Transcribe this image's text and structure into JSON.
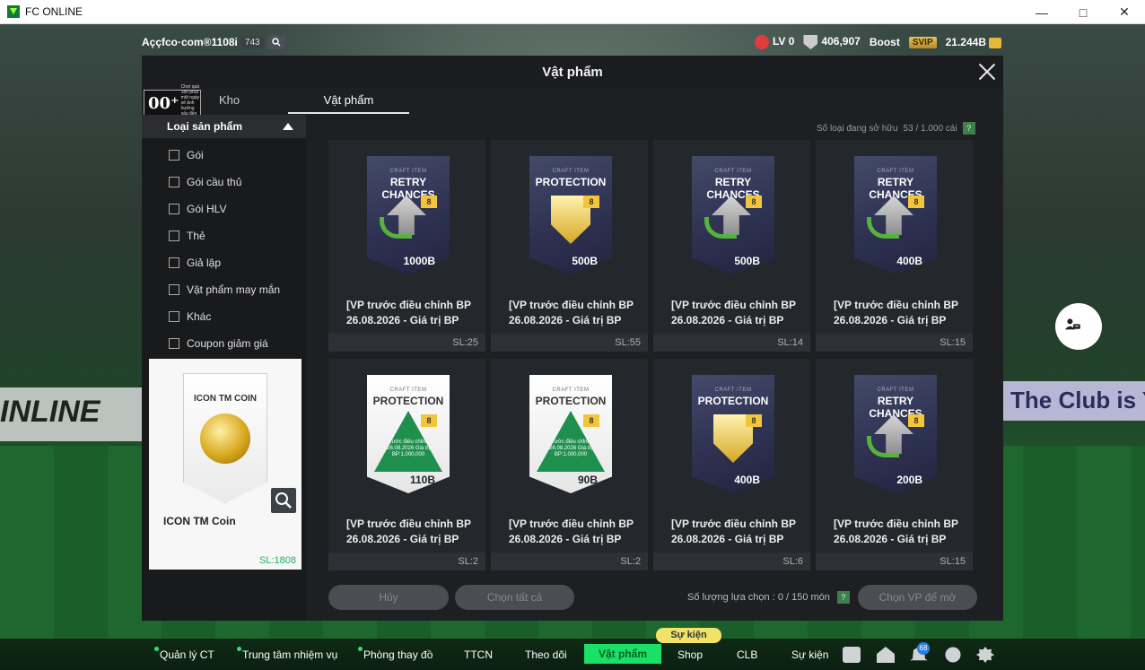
{
  "window": {
    "title": "FC ONLINE"
  },
  "topbar": {
    "account": "Aççfco·com®1108i",
    "account_count": "743",
    "level": "LV 0",
    "points": "406,907",
    "boost_label": "Boost",
    "svip": "SVIP",
    "bp": "21.244B"
  },
  "dialog": {
    "title": "Vật phẩm",
    "tab_kho": "Kho",
    "tab_vatpham": "Vật phẩm",
    "age_rating": "00⁺",
    "age_note": "Chơi quá 180 phút một ngày sẽ ảnh hưởng xấu đến sức khỏe",
    "owned_label": "Số loại đang sở hữu",
    "owned_value": "53 / 1.000 cái",
    "help": "?"
  },
  "sidebar": {
    "category_title": "Loại sản phẩm",
    "items": [
      {
        "label": "Gói"
      },
      {
        "label": "Gói cầu thủ"
      },
      {
        "label": "Gói HLV"
      },
      {
        "label": "Thẻ"
      },
      {
        "label": "Giả lập"
      },
      {
        "label": "Vật phẩm may mắn"
      },
      {
        "label": "Khác"
      },
      {
        "label": "Coupon giảm giá"
      }
    ]
  },
  "preview": {
    "card_title": "ICON TM COIN",
    "name": "ICON TM Coin",
    "qty": "SL:1808"
  },
  "items": [
    {
      "craft": "CRAFT ITEM",
      "title": "RETRY CHANCES",
      "value": "1000B",
      "label1": "[VP trước điều chỉnh BP",
      "label2": "26.08.2026 - Giá trị BP",
      "qty": "SL:25"
    },
    {
      "craft": "CRAFT ITEM",
      "title": "PROTECTION",
      "value": "500B",
      "label1": "[VP trước điều chỉnh BP",
      "label2": "26.08.2026 - Giá trị BP",
      "qty": "SL:55"
    },
    {
      "craft": "CRAFT ITEM",
      "title": "RETRY CHANCES",
      "value": "500B",
      "label1": "[VP trước điều chỉnh BP",
      "label2": "26.08.2026 - Giá trị BP",
      "qty": "SL:14"
    },
    {
      "craft": "CRAFT ITEM",
      "title": "RETRY CHANCES",
      "value": "400B",
      "label1": "[VP trước điều chỉnh BP",
      "label2": "26.08.2026 - Giá trị BP",
      "qty": "SL:15"
    },
    {
      "craft": "CRAFT ITEM",
      "title": "PROTECTION",
      "value": "110B",
      "warn": "VP trước điều chỉnh BP 26.08.2026 Giá trị BP:1,000,000",
      "label1": "[VP trước điều chỉnh BP",
      "label2": "26.08.2026 - Giá trị BP",
      "qty": "SL:2"
    },
    {
      "craft": "CRAFT ITEM",
      "title": "PROTECTION",
      "value": "90B",
      "warn": "VP trước điều chỉnh BP 26.08.2026 Giá trị BP:1,000,000",
      "label1": "[VP trước điều chỉnh BP",
      "label2": "26.08.2026 - Giá trị BP",
      "qty": "SL:2"
    },
    {
      "craft": "CRAFT ITEM",
      "title": "PROTECTION",
      "value": "400B",
      "label1": "[VP trước điều chỉnh BP",
      "label2": "26.08.2026 - Giá trị BP",
      "qty": "SL:6"
    },
    {
      "craft": "CRAFT ITEM",
      "title": "RETRY CHANCES",
      "value": "200B",
      "label1": "[VP trước điều chỉnh BP",
      "label2": "26.08.2026 - Giá trị BP",
      "qty": "SL:15"
    }
  ],
  "actions": {
    "cancel": "Hủy",
    "select_all": "Chọn tất cả",
    "selected_label": "Số lượng lựa chọn : 0 / 150 món",
    "choose": "Chọn VP để mở"
  },
  "background": {
    "left_banner": "INLINE",
    "right_banner": "The Club is Y"
  },
  "nav": {
    "items": [
      {
        "label": "Quản lý CT"
      },
      {
        "label": "Trung tâm nhiệm vụ"
      },
      {
        "label": "Phòng thay đồ"
      },
      {
        "label": "TTCN"
      },
      {
        "label": "Theo dõi"
      },
      {
        "label": "Vật phẩm"
      },
      {
        "label": "Shop"
      },
      {
        "label": "CLB"
      },
      {
        "label": "Sự kiện"
      }
    ],
    "event_badge": "Sự kiện",
    "notif_count": "68"
  },
  "colors": {
    "accent": "#1be067",
    "sl_green": "#1bb45a",
    "dialog_bg": "#1d1f22"
  }
}
